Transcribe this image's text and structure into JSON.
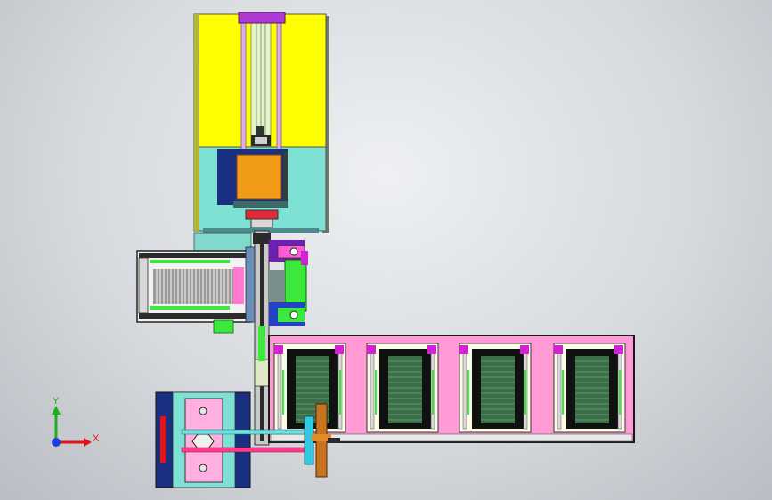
{
  "viewport": {
    "name": "cad-3d-viewport",
    "background": "#d9dcdf"
  },
  "triad": {
    "y_label": "Y",
    "x_label": "X",
    "x_color": "#e0141a",
    "y_color": "#19b21b",
    "origin_color": "#1f3bd6"
  },
  "colors": {
    "yellow": "#ffff00",
    "cyan": "#7fe0d4",
    "orange": "#f09a18",
    "navy": "#1a2f80",
    "pink": "#ff9ad5",
    "magenta": "#d223d2",
    "green": "#3be83b",
    "purple": "#6e1fb4",
    "blue": "#2342c8",
    "dark_green": "#2f5d3a"
  },
  "assemblies": [
    "upper-cylinder-module",
    "left-feeder-module",
    "vertical-transfer-rail",
    "right-indexing-table",
    "bottom-drive-module"
  ]
}
